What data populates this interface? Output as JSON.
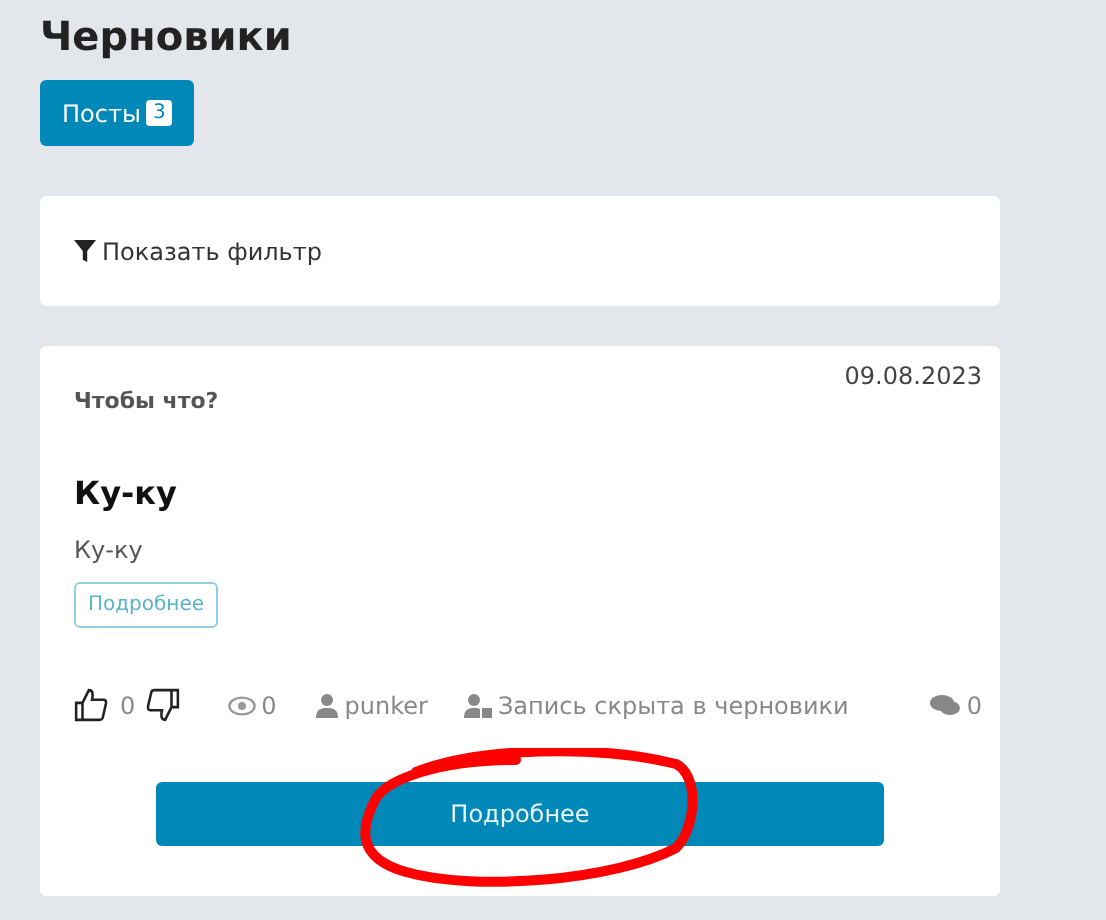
{
  "page": {
    "title": "Черновики"
  },
  "tabs": [
    {
      "label": "Посты",
      "count": "3",
      "selected": true
    }
  ],
  "filter": {
    "label": "Показать фильтр"
  },
  "post": {
    "date": "09.08.2023",
    "subtitle": "Чтобы что?",
    "title": "Ку-ку",
    "text": "Ку-ку",
    "more_link": "Подробнее",
    "stats": {
      "likes": "0",
      "views": "0",
      "author": "punker",
      "status": "Запись скрыта в черновики",
      "comments": "0"
    },
    "more_button": "Подробнее"
  },
  "annotation": {
    "kind": "circle",
    "color": "#ff0000"
  }
}
